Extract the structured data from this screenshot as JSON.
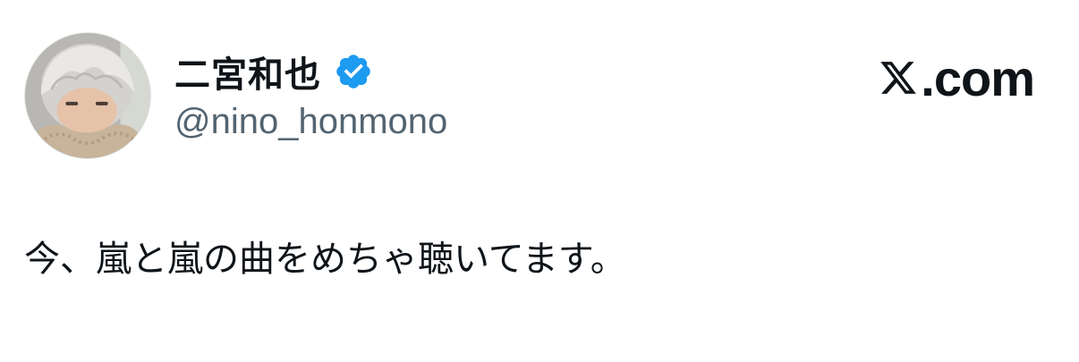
{
  "author": {
    "display_name": "二宮和也",
    "handle": "@nino_honmono",
    "verified": true,
    "avatar": "profile-photo-icon"
  },
  "brand": {
    "domain": "X.com",
    "domain_suffix": ".com",
    "logo": "x-logo-icon"
  },
  "tweet": {
    "text": "今、嵐と嵐の曲をめちゃ聴いてます。"
  },
  "colors": {
    "text": "#0f1419",
    "secondary_text": "#536471",
    "verified_badge": "#1d9bf0",
    "background": "#ffffff"
  }
}
